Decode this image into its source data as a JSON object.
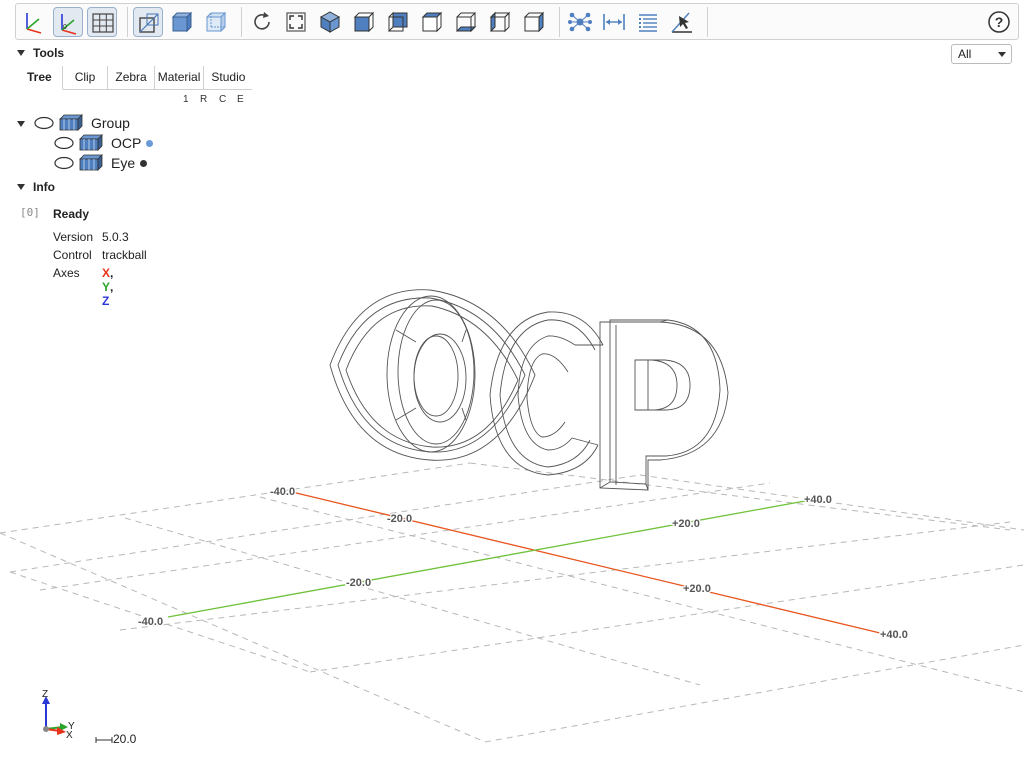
{
  "toolbar": {
    "buttons": [
      {
        "name": "axes-toggle-button",
        "icon": "axes-icon",
        "active": false
      },
      {
        "name": "axes0-toggle-button",
        "icon": "axes-origin-icon",
        "active": true
      },
      {
        "name": "grid-toggle-button",
        "icon": "grid-icon",
        "active": true
      },
      {
        "name": "perspective-button",
        "icon": "perspective-icon",
        "active": true
      },
      {
        "name": "transparent-button",
        "icon": "transparent-icon",
        "active": false
      },
      {
        "name": "black-edges-button",
        "icon": "black-edges-icon",
        "active": false
      },
      {
        "name": "reset-view-button",
        "icon": "reset-icon",
        "active": false
      },
      {
        "name": "resize-button",
        "icon": "fit-icon",
        "active": false
      },
      {
        "name": "view-iso-button",
        "icon": "iso-view-icon",
        "active": false
      },
      {
        "name": "view-front-button",
        "icon": "front-view-icon",
        "active": false
      },
      {
        "name": "view-rear-button",
        "icon": "rear-view-icon",
        "active": false
      },
      {
        "name": "view-top-button",
        "icon": "top-view-icon",
        "active": false
      },
      {
        "name": "view-bottom-button",
        "icon": "bottom-view-icon",
        "active": false
      },
      {
        "name": "view-left-button",
        "icon": "left-view-icon",
        "active": false
      },
      {
        "name": "view-right-button",
        "icon": "right-view-icon",
        "active": false
      },
      {
        "name": "explode-button",
        "icon": "explode-icon",
        "active": false
      },
      {
        "name": "distance-button",
        "icon": "distance-icon",
        "active": false
      },
      {
        "name": "properties-button",
        "icon": "properties-icon",
        "active": false
      },
      {
        "name": "select-button",
        "icon": "select-icon",
        "active": false
      }
    ],
    "help_icon": "help-icon"
  },
  "tools": {
    "title": "Tools",
    "tabs": [
      "Tree",
      "Clip",
      "Zebra",
      "Material",
      "Studio"
    ],
    "active_tab": "Tree",
    "columns": [
      "1",
      "R",
      "C",
      "E"
    ]
  },
  "tree": {
    "nodes": [
      {
        "label": "Group",
        "level": 0,
        "expanded": true,
        "dot": null
      },
      {
        "label": "OCP",
        "level": 1,
        "dot": "#6a9ad8"
      },
      {
        "label": "Eye",
        "level": 1,
        "dot": "#333333"
      }
    ]
  },
  "info": {
    "title": "Info",
    "index": "[0]",
    "status": "Ready",
    "rows": [
      {
        "label": "Version",
        "value": "5.0.3"
      },
      {
        "label": "Control",
        "value": "trackball"
      }
    ],
    "axes_label": "Axes",
    "axes": [
      {
        "text": "X",
        "color": "#e8331a"
      },
      {
        "text": "Y",
        "color": "#2aa52a"
      },
      {
        "text": "Z",
        "color": "#2a39d6"
      }
    ]
  },
  "view_select": {
    "value": "All"
  },
  "grid_labels": {
    "x_axis": [
      "-40.0",
      "-20.0",
      "+20.0",
      "+40.0"
    ],
    "y_axis": [
      "-40.0",
      "-20.0",
      "+20.0",
      "+40.0"
    ]
  },
  "orientation": {
    "z": "Z",
    "y": "Y",
    "x": "X"
  },
  "scale": {
    "value": "20.0"
  },
  "colors": {
    "x_axis": "#e8561f",
    "y_axis": "#6fc23a",
    "accent": "#4a78b8"
  }
}
